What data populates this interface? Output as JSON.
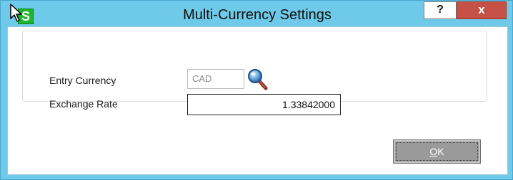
{
  "window": {
    "title": "Multi-Currency Settings",
    "app_icon_letter": "S",
    "help_label": "?",
    "close_label": "x"
  },
  "form": {
    "entry_currency": {
      "label": "Entry Currency",
      "value": "CAD",
      "lookup_icon": "magnifier-icon"
    },
    "exchange_rate": {
      "label": "Exchange Rate",
      "value": "1.33842000"
    }
  },
  "buttons": {
    "ok_label_mnemonic": "O",
    "ok_label_rest": "K"
  },
  "colors": {
    "titlebar": "#6ecae8",
    "close_button": "#c75046",
    "app_icon": "#1fb52f",
    "ok_button": "#9a9a9a"
  }
}
